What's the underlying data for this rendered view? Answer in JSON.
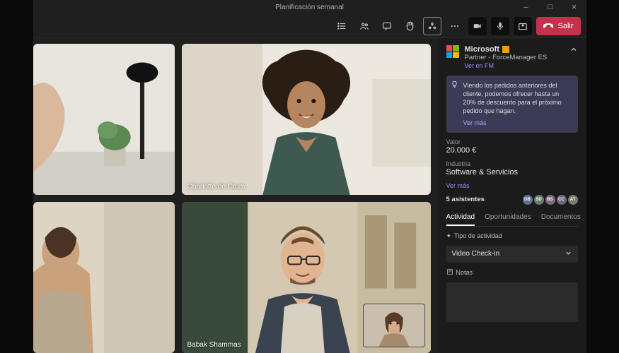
{
  "window": {
    "title": "Planificación semanal"
  },
  "toolbar": {
    "leave_label": "Salir"
  },
  "tiles": {
    "t1_name": "Charlotte de Crum",
    "t3_name": "Babak Shammas"
  },
  "panel": {
    "company": "Microsoft",
    "subtitle": "Partner - ForceManager ES",
    "fm_link": "Ver en FM",
    "tip": "Viendo los pedidos anteriores del cliente, podemos ofrecer hasta un 20% de descuento para el próximo pedido que hagan.",
    "tip_more": "Ver más",
    "valor_label": "Valor",
    "valor_value": "20.000 €",
    "industria_label": "Industria",
    "industria_value": "Software & Servicios",
    "more2": "Ver más",
    "attendees": "5 asistentes",
    "avatars": [
      {
        "initials": "DB",
        "color": "#5f6f8f"
      },
      {
        "initials": "SD",
        "color": "#6a7a6a"
      },
      {
        "initials": "BS",
        "color": "#7a6a7a"
      },
      {
        "initials": "CC",
        "color": "#6a6a7a"
      },
      {
        "initials": "AT",
        "color": "#7a7a6a"
      }
    ],
    "tabs": {
      "actividad": "Actividad",
      "oportunidades": "Oportunidades",
      "documentos": "Documentos"
    },
    "activity_type_label": "Tipo de actividad",
    "activity_type_value": "Video Check-in",
    "notes_label": "Notas"
  }
}
